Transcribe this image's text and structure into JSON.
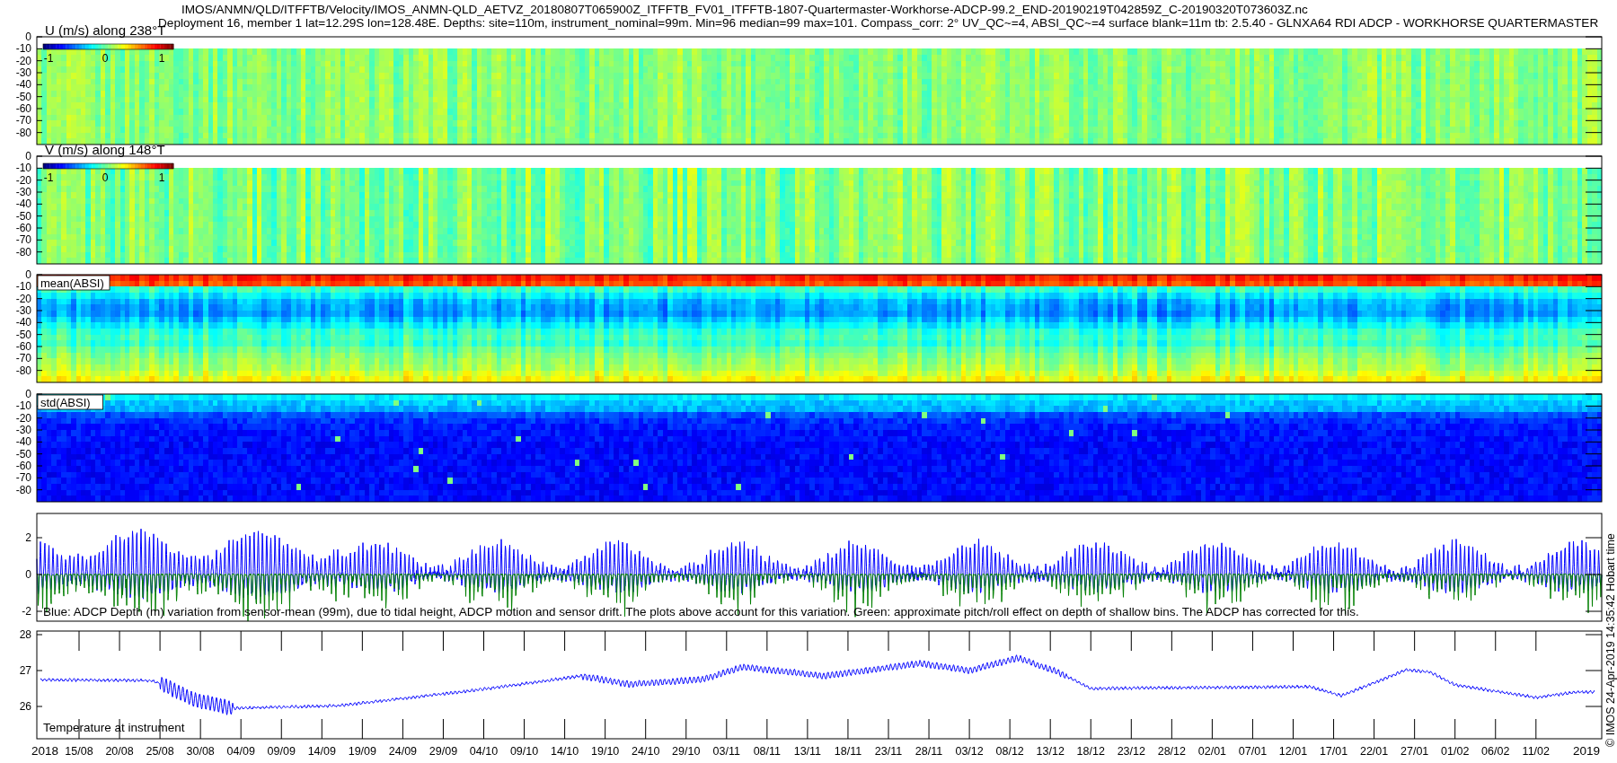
{
  "header": {
    "title": "IMOS/ANMN/QLD/ITFFTB/Velocity/IMOS_ANMN-QLD_AETVZ_20180807T065900Z_ITFFTB_FV01_ITFFTB-1807-Quartermaster-Workhorse-ADCP-99.2_END-20190219T042859Z_C-20190320T073603Z.nc",
    "subtitle": "Deployment 16, member 1 lat=12.29S lon=128.48E. Depths: site=110m, instrument_nominal=99m. Min=96 median=99 max=101. Compass_corr: 2° UV_QC~=4, ABSI_QC~=4 surface blank=11m tb: 2.5.40 - GLNXA64 RDI ADCP - WORKHORSE QUARTERMASTER"
  },
  "panels": [
    {
      "kind": "u",
      "title": "U (m/s) along 238°T",
      "colorbar_ticks": [
        "-1",
        "0",
        "1"
      ],
      "yticks": [
        "0",
        "-10",
        "-20",
        "-30",
        "-40",
        "-50",
        "-60",
        "-70",
        "-80"
      ]
    },
    {
      "kind": "v",
      "title": "V (m/s) along 148°T",
      "colorbar_ticks": [
        "-1",
        "0",
        "1"
      ],
      "yticks": [
        "0",
        "-10",
        "-20",
        "-30",
        "-40",
        "-50",
        "-60",
        "-70",
        "-80"
      ]
    },
    {
      "kind": "mean",
      "title": "mean(ABSI)",
      "yticks": [
        "0",
        "-10",
        "-20",
        "-30",
        "-40",
        "-50",
        "-60",
        "-70",
        "-80"
      ]
    },
    {
      "kind": "std",
      "title": "std(ABSI)",
      "yticks": [
        "0",
        "-10",
        "-20",
        "-30",
        "-40",
        "-50",
        "-60",
        "-70",
        "-80"
      ]
    },
    {
      "kind": "depth",
      "caption": "Blue: ADCP Depth (m) variation from sensor-mean (99m), due to tidal height, ADCP motion and sensor drift. The plots above account for this variation. Green: approximate pitch/roll effect on depth of shallow bins. The ADCP has corrected for this.",
      "yticks": [
        "2",
        "0",
        "-2"
      ]
    },
    {
      "kind": "temperature",
      "title": "Temperature at instrument",
      "yticks": [
        "28",
        "27",
        "26"
      ]
    }
  ],
  "time_axis": {
    "start_label": "2018",
    "end_label": "2019",
    "dates": [
      "15/08",
      "20/08",
      "25/08",
      "30/08",
      "04/09",
      "09/09",
      "14/09",
      "19/09",
      "24/09",
      "29/09",
      "04/10",
      "09/10",
      "14/10",
      "19/10",
      "24/10",
      "29/10",
      "03/11",
      "08/11",
      "13/11",
      "18/11",
      "23/11",
      "28/11",
      "03/12",
      "08/12",
      "13/12",
      "18/12",
      "23/12",
      "28/12",
      "02/01",
      "07/01",
      "12/01",
      "17/01",
      "22/01",
      "27/01",
      "01/02",
      "06/02",
      "11/02"
    ]
  },
  "credit": "© IMOS 24-Apr-2019 14:35:42 Hobart time"
}
